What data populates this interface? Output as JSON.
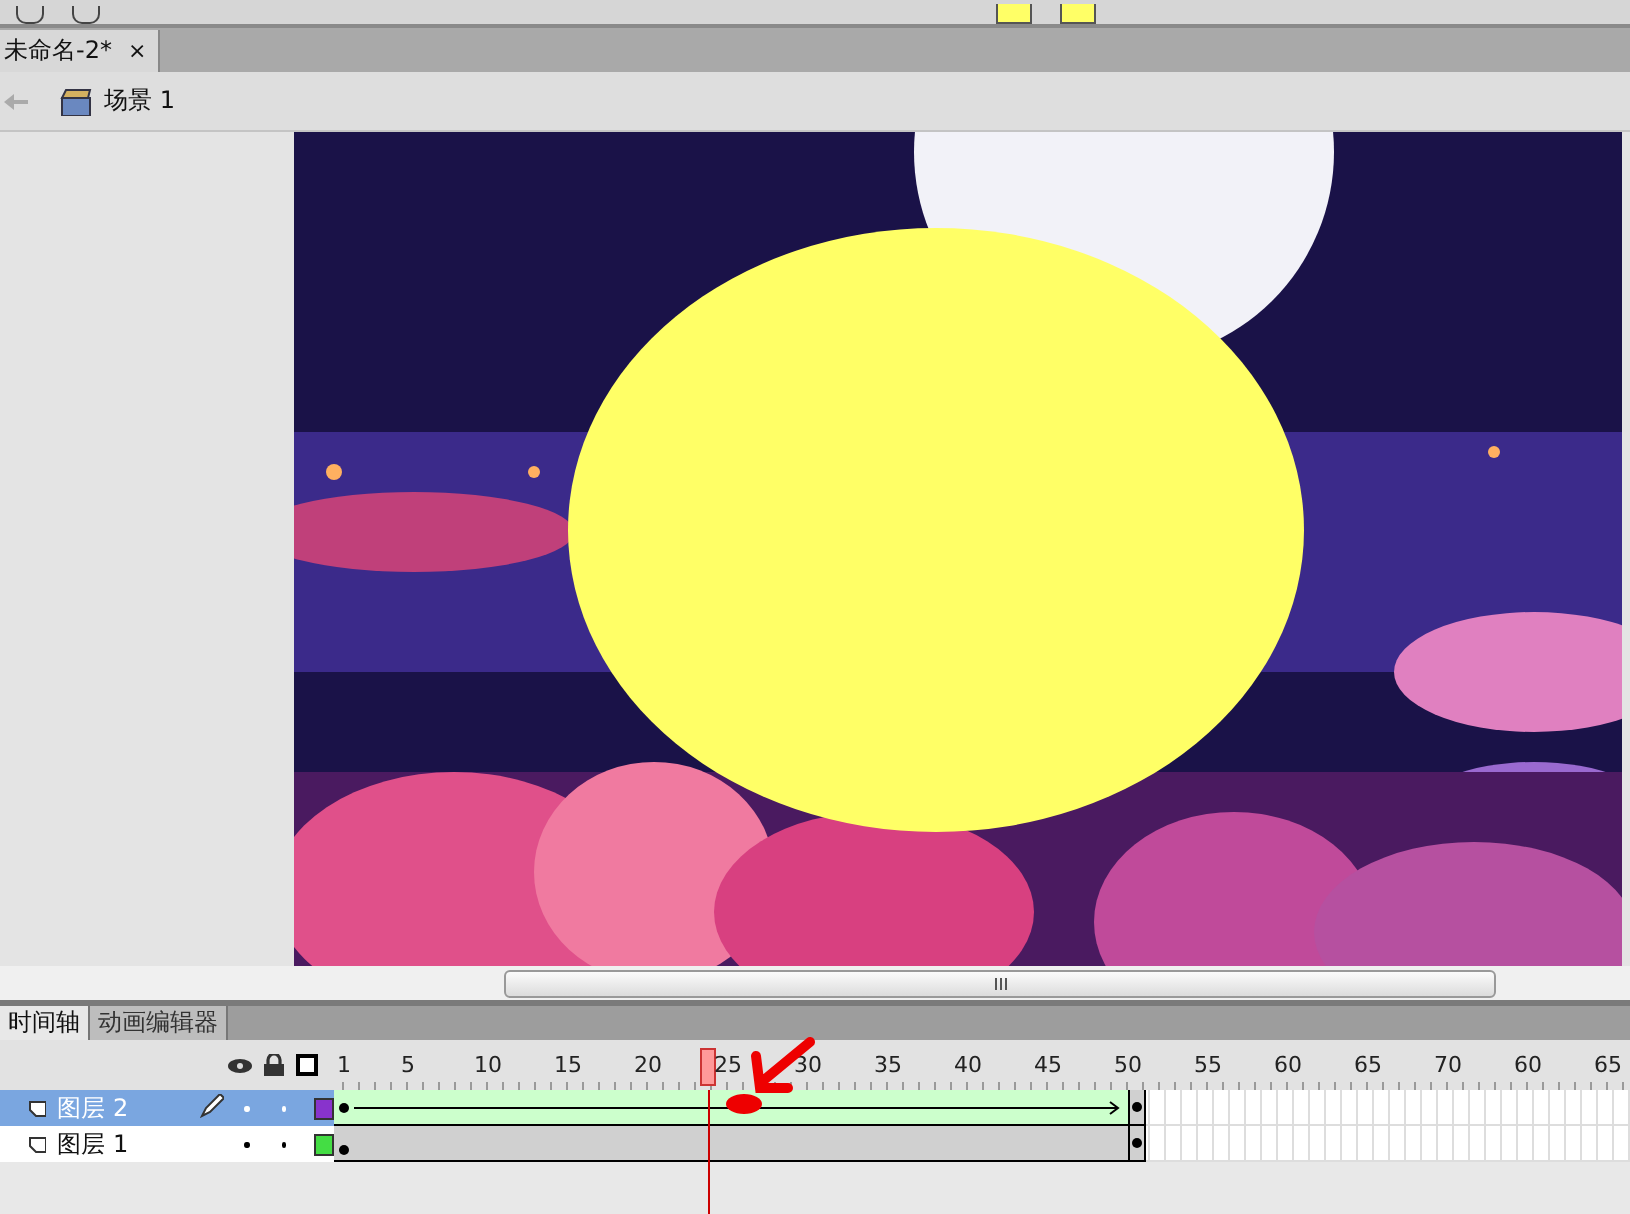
{
  "document_tab": {
    "title": "未命名-2*",
    "close": "×"
  },
  "breadcrumb": {
    "scene": "场景 1"
  },
  "panel_tabs": [
    {
      "label": "时间轴",
      "selected": true
    },
    {
      "label": "动画编辑器",
      "selected": false
    }
  ],
  "ruler": {
    "labels": [
      "1",
      "5",
      "10",
      "15",
      "20",
      "25",
      "30",
      "35",
      "40",
      "45",
      "50",
      "55",
      "60",
      "65",
      "70",
      "60",
      "65"
    ],
    "playhead": {
      "level": 0.283
    }
  },
  "layers": [
    {
      "name": "图层 2",
      "selected": true,
      "editing": true,
      "color": "#8833cc",
      "tween": true
    },
    {
      "name": "图层 1",
      "selected": false,
      "editing": false,
      "color": "#44dd44",
      "tween": false
    }
  ]
}
